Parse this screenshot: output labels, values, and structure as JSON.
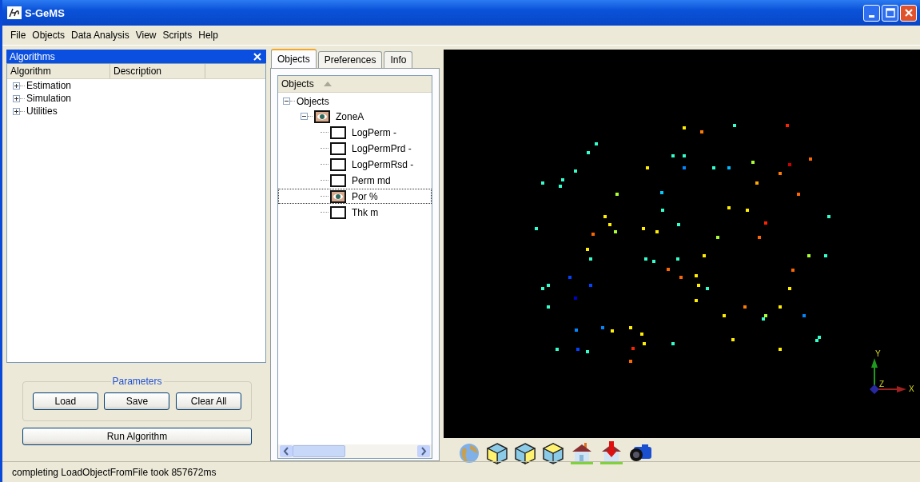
{
  "window": {
    "title": "S-GeMS"
  },
  "menu": [
    "File",
    "Objects",
    "Data Analysis",
    "View",
    "Scripts",
    "Help"
  ],
  "algorithms_panel": {
    "title": "Algorithms",
    "columns": [
      "Algorithm",
      "Description"
    ],
    "items": [
      {
        "label": "Estimation",
        "expanded": false
      },
      {
        "label": "Simulation",
        "expanded": false
      },
      {
        "label": "Utilities",
        "expanded": false
      }
    ],
    "parameters": {
      "title": "Parameters",
      "buttons": [
        "Load",
        "Save",
        "Clear All"
      ]
    },
    "run_button": "Run Algorithm"
  },
  "tabs": [
    {
      "label": "Objects",
      "selected": true
    },
    {
      "label": "Preferences",
      "selected": false
    },
    {
      "label": "Info",
      "selected": false
    }
  ],
  "objects_tree": {
    "header": "Objects",
    "items": [
      {
        "label": "Objects",
        "expanded": true,
        "children": [
          {
            "label": "ZoneA",
            "expanded": true,
            "visible": true,
            "children": [
              {
                "label": "LogPerm -",
                "visible": false,
                "selected": false
              },
              {
                "label": "LogPermPrd -",
                "visible": false,
                "selected": false
              },
              {
                "label": "LogPermRsd -",
                "visible": false,
                "selected": false
              },
              {
                "label": "Perm md",
                "visible": false,
                "selected": false
              },
              {
                "label": "Por %",
                "visible": true,
                "selected": true
              },
              {
                "label": "Thk m",
                "visible": false,
                "selected": false
              }
            ]
          }
        ]
      }
    ]
  },
  "viewport": {
    "axes": {
      "x": "X",
      "y": "Y",
      "z": "Z"
    }
  },
  "status_bar": "completing LoadObjectFromFile took 857672ms"
}
